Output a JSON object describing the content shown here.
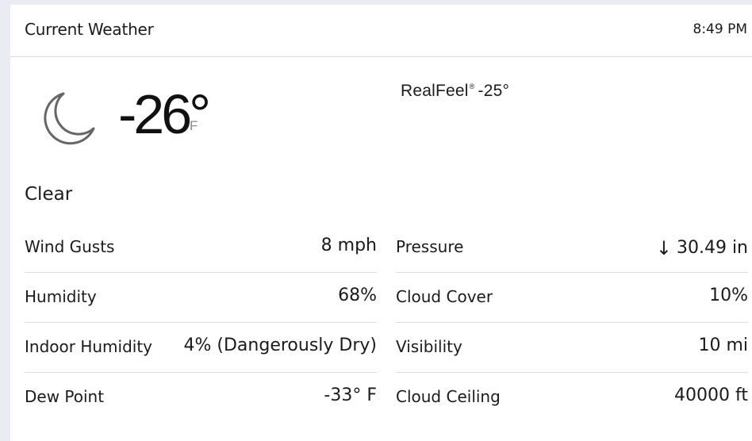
{
  "header": {
    "title": "Current Weather",
    "time": "8:49 PM"
  },
  "current": {
    "icon": "moon-icon",
    "temperature": "-26°",
    "unit": "F",
    "realfeel_label": "RealFeel",
    "realfeel_mark": "®",
    "realfeel_value": "-25°",
    "condition": "Clear"
  },
  "details": {
    "left": [
      {
        "label": "Wind Gusts",
        "value": "8 mph"
      },
      {
        "label": "Humidity",
        "value": "68%"
      },
      {
        "label": "Indoor Humidity",
        "value": "4% (Dangerously Dry)"
      },
      {
        "label": "Dew Point",
        "value": "-33° F"
      }
    ],
    "right": [
      {
        "label": "Pressure",
        "arrow": "↓",
        "value": "30.49 in"
      },
      {
        "label": "Cloud Cover",
        "value": "10%"
      },
      {
        "label": "Visibility",
        "value": "10 mi"
      },
      {
        "label": "Cloud Ceiling",
        "value": "40000 ft"
      }
    ]
  }
}
